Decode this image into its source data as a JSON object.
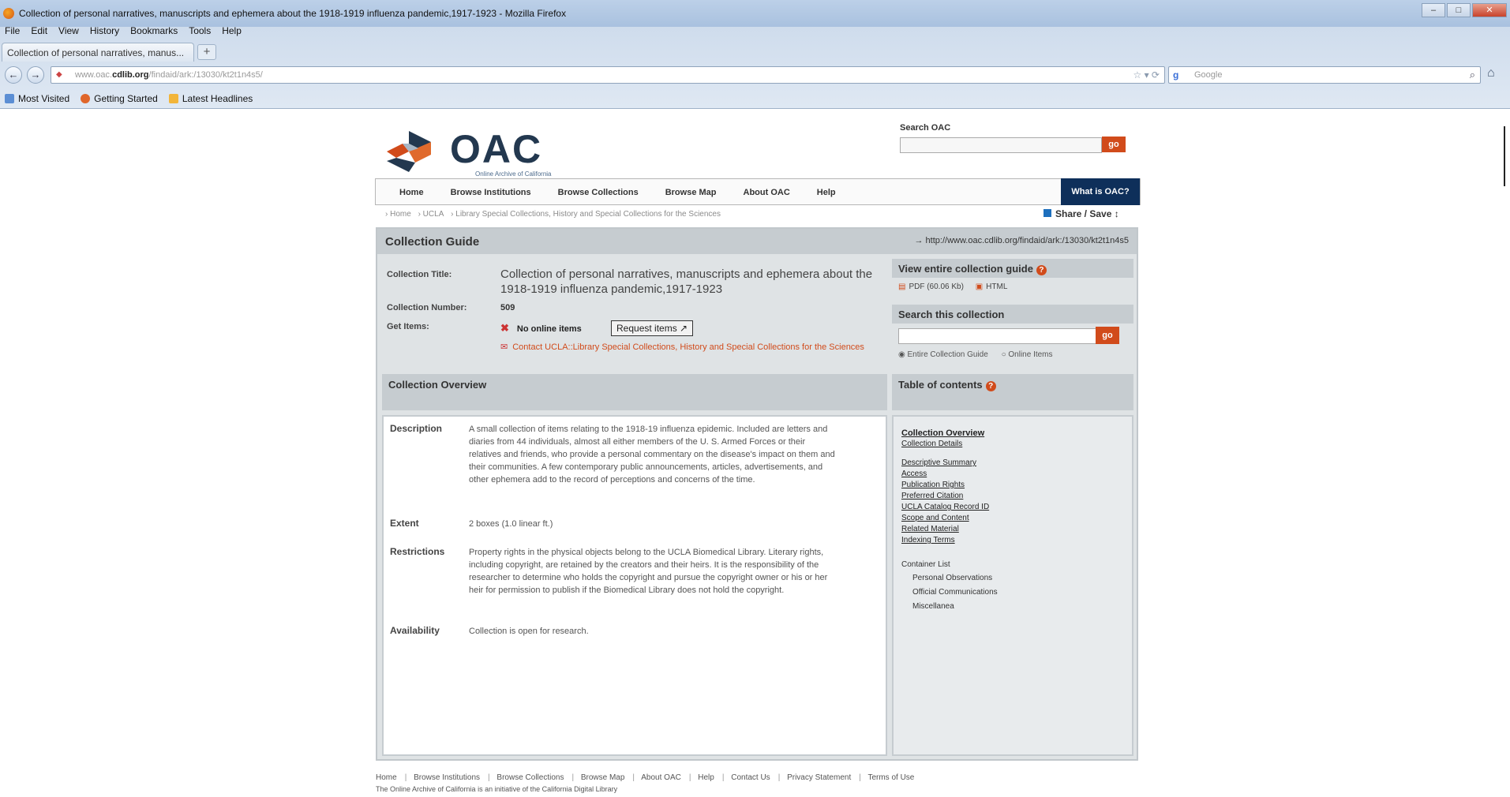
{
  "window": {
    "title": "Collection of personal narratives, manuscripts and ephemera about the 1918-1919 influenza pandemic,1917-1923 - Mozilla Firefox",
    "buttons": [
      "–",
      "□",
      "✕"
    ]
  },
  "menu": [
    "File",
    "Edit",
    "View",
    "History",
    "Bookmarks",
    "Tools",
    "Help"
  ],
  "tab": {
    "label": "Collection of personal narratives, manus...",
    "new_tab": "+"
  },
  "url": {
    "prefix": "www.oac.",
    "domain": "cdlib.org",
    "path": "/findaid/ark:/13030/kt2t1n4s5/"
  },
  "search_engine": {
    "placeholder": "Google"
  },
  "bookmarks": [
    {
      "label": "Most Visited",
      "color": "#5b8ed4"
    },
    {
      "label": "Getting Started",
      "color": "#e0662a"
    },
    {
      "label": "Latest Headlines",
      "color": "#f2b53a"
    }
  ],
  "site": {
    "logo_text": "OAC",
    "logo_sub": "Online Archive of California",
    "search_label": "Search OAC",
    "go": "go",
    "nav": [
      "Home",
      "Browse Institutions",
      "Browse Collections",
      "Browse Map",
      "About OAC",
      "Help"
    ],
    "what_is": "What is OAC?",
    "breadcrumbs": [
      "› Home",
      "› UCLA",
      "› Library Special Collections, History and Special Collections for the Sciences"
    ],
    "share": "Share / Save ↕"
  },
  "guide": {
    "heading": "Collection Guide",
    "permalink": "→ http://www.oac.cdlib.org/findaid/ark:/13030/kt2t1n4s5",
    "collection_title_label": "Collection Title:",
    "collection_title": "Collection of personal narratives, manuscripts and ephemera about the 1918-1919 influenza pandemic,1917-1923",
    "collection_number_label": "Collection Number:",
    "collection_number": "509",
    "get_items_label": "Get Items:",
    "no_online": "No online items",
    "request_items": "Request items ↗",
    "contact": "Contact UCLA::Library Special Collections, History and Special Collections for the Sciences",
    "overview_heading": "Collection Overview",
    "description_label": "Description",
    "description": "A small collection of items relating to the 1918-19 influenza epidemic. Included are letters and diaries from 44 individuals, almost all either members of the U. S. Armed Forces or their relatives and friends, who provide a personal commentary on the disease's impact on them and their communities. A few contemporary public announcements, articles, advertisements, and other ephemera add to the record of perceptions and concerns of the time.",
    "extent_label": "Extent",
    "extent": "2 boxes (1.0 linear ft.)",
    "restrictions_label": "Restrictions",
    "restrictions": "Property rights in the physical objects belong to the UCLA Biomedical Library. Literary rights, including copyright, are retained by the creators and their heirs. It is the responsibility of the researcher to determine who holds the copyright and pursue the copyright owner or his or her heir for permission to publish if the Biomedical Library does not hold the copyright.",
    "availability_label": "Availability",
    "availability": "Collection is open for research."
  },
  "sidebar": {
    "view_guide_heading": "View entire collection guide",
    "pdf": "PDF (60.06 Kb)",
    "html": "HTML",
    "search_heading": "Search this collection",
    "go": "go",
    "radio_entire": "◉ Entire Collection Guide",
    "radio_online": "○ Online Items",
    "toc_heading": "Table of contents",
    "toc_major": [
      "Collection Overview",
      "Collection Details"
    ],
    "toc_links": [
      "Descriptive Summary",
      "Access",
      "Publication Rights",
      "Preferred Citation",
      "UCLA Catalog Record ID",
      "Scope and Content",
      "Related Material",
      "Indexing Terms"
    ],
    "container_list": "Container List",
    "container_items": [
      "Personal Observations",
      "Official Communications",
      "Miscellanea"
    ]
  },
  "footer": {
    "links": [
      "Home",
      "Browse Institutions",
      "Browse Collections",
      "Browse Map",
      "About OAC",
      "Help",
      "Contact Us",
      "Privacy Statement",
      "Terms of Use"
    ],
    "tagline": "The Online Archive of California is an initiative of the California Digital Library"
  }
}
